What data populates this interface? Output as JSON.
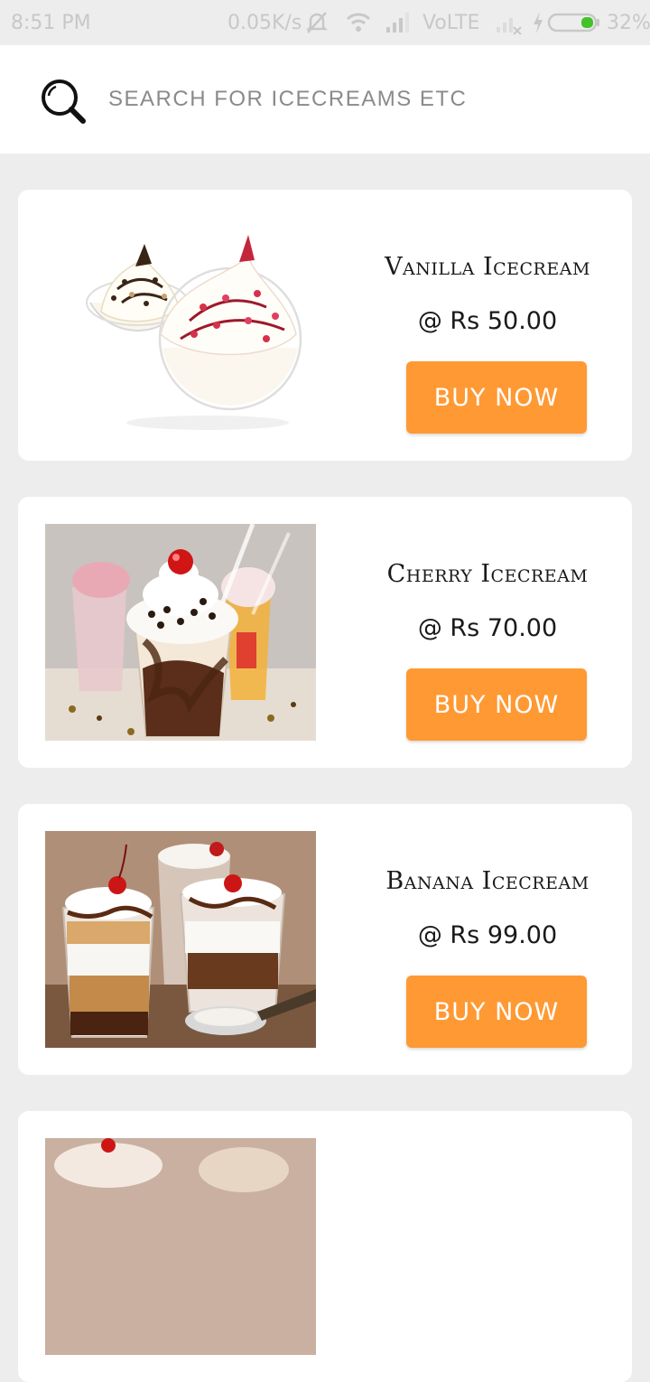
{
  "status_bar": {
    "time": "8:51 PM",
    "network_speed": "0.05K/s",
    "volte": "VoLTE",
    "battery_percent": "32%",
    "icons": [
      "muted-icon",
      "wifi-icon",
      "signal-icon",
      "no-signal-icon",
      "charging-icon",
      "battery-icon"
    ]
  },
  "search": {
    "placeholder": "SEARCH FOR ICECREAMS ETC",
    "icon": "search-icon"
  },
  "colors": {
    "accent": "#ff9933",
    "background": "#ededed",
    "card": "#ffffff",
    "battery_fill": "#43c22b"
  },
  "products": [
    {
      "name": "Vanilla Icecream",
      "price": "@ Rs 50.00",
      "button_label": "BUY NOW",
      "image": "vanilla-icecream-cups"
    },
    {
      "name": "Cherry Icecream",
      "price": "@ Rs 70.00",
      "button_label": "BUY NOW",
      "image": "cherry-icecream-sundae"
    },
    {
      "name": "Banana Icecream",
      "price": "@ Rs 99.00",
      "button_label": "BUY NOW",
      "image": "banana-icecream-parfait"
    },
    {
      "name": "",
      "price": "",
      "button_label": "",
      "image": "partial-product-image"
    }
  ]
}
